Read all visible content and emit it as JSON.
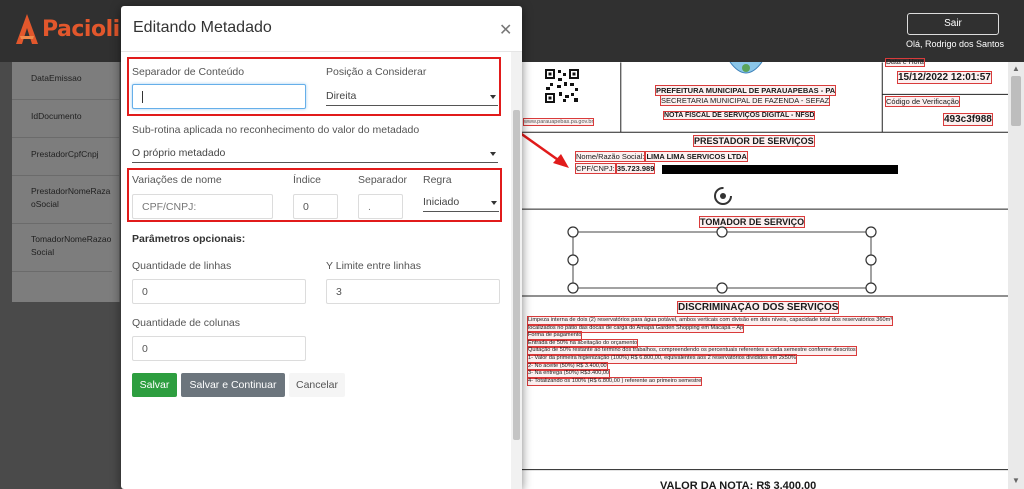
{
  "app": {
    "name": "Pacioli",
    "brand_color": "#e2572c"
  },
  "header": {
    "logout_label": "Sair",
    "user_label": "Olá, Rodrigo dos Santos"
  },
  "left_list": {
    "items": [
      {
        "label": "DataEmissao"
      },
      {
        "label": "IdDocumento"
      },
      {
        "label": "PrestadorCpfCnpj"
      },
      {
        "label": "PrestadorNomeRazaoSocial"
      },
      {
        "label": "TomadorNomeRazaoSocial"
      }
    ]
  },
  "document": {
    "city_header": "PREFEITURA MUNICIPAL DE PARAUAPEBAS - PA",
    "secretary": "SECRETARIA MUNICIPAL DE FAZENDA - SEFAZ",
    "nfse_title": "NOTA FISCAL DE SERVIÇOS DIGITAL - NFSD",
    "date_label": "Data e Hora",
    "date_value": "15/12/2022 12:01:57",
    "verify_label": "Código de Verificação",
    "verify_value": "493c3f988",
    "qr_caption": "www.parauapebas.pa.gov.br",
    "provider_section": "PRESTADOR DE SERVIÇOS",
    "provider_name_label": "Nome/Razão Social:",
    "provider_name_value": "LIMA LIMA SERVICOS LTDA",
    "provider_doc_label": "CPF/CNPJ:",
    "provider_doc_value": "35.723.989",
    "taker_section": "TOMADOR DE SERVIÇO",
    "services_section": "DISCRIMINAÇÃO DOS SERVIÇOS",
    "service_lines": [
      "Limpeza interna de dois (2) reservatórios para água potável, ambos verticais com divisão em dois níveis, capacidade total dos reservatórios 360m³",
      "localizados no pátio das docas de carga do Amapá Garden Shopping em Macapá – Ap",
      "Forma de pagamento",
      "Entrada de 50% na aceitação do orçamento",
      "Quitação de 50% restante ao termino dos trabalhos, compreendendo os percentuais referentes a cada semestre conforme descritos",
      "1- Valor da primeira higienização (100%) R$ 6.800,00, equivalentes aos 2 reservatórios divididos em 2x50%",
      "2- No aceite (50%) R$ 3.400,00",
      "3- Na entrega (50%) R$3.400,00",
      "4- Totalizando os 100% (R$ 6.800,00 ) referente ao primeiro semestre"
    ],
    "total_label": "VALOR DA NOTA: R$ 3.400,00"
  },
  "modal": {
    "title": "Editando Metadado",
    "content_separator_label": "Separador de Conteúdo",
    "content_separator_value": "",
    "position_label": "Posição a Considerar",
    "position_value": "Direita",
    "subroutine_label": "Sub-rotina aplicada no reconhecimento do valor do metadado",
    "subroutine_value": "O próprio metadado",
    "name_variations_label": "Variações de nome",
    "name_variations_value": "CPF/CNPJ:",
    "index_label": "Índice",
    "index_value": "0",
    "separator_label": "Separador",
    "separator_value": ".",
    "rule_label": "Regra",
    "rule_value": "Iniciado",
    "optional_params_label": "Parâmetros opcionais:",
    "line_count_label": "Quantidade de linhas",
    "line_count_value": "0",
    "y_limit_label": "Y Limite entre linhas",
    "y_limit_value": "3",
    "column_count_label": "Quantidade de colunas",
    "column_count_value": "0",
    "save_label": "Salvar",
    "save_continue_label": "Salvar e Continuar",
    "cancel_label": "Cancelar"
  },
  "colors": {
    "save_green": "#2d9e3f",
    "annotation_red": "#e11b1b",
    "highlight_red": "#d93b3b"
  }
}
